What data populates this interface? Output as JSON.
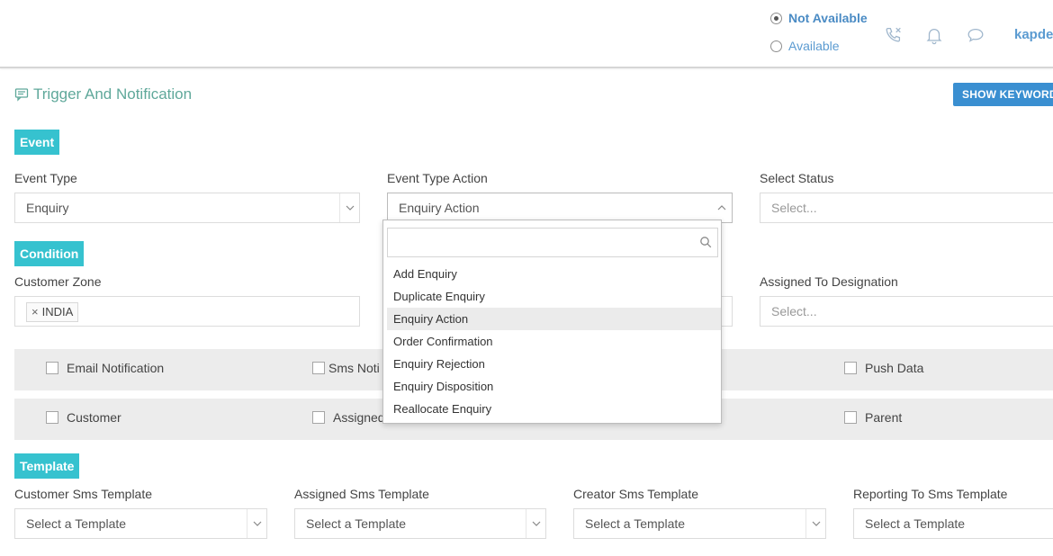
{
  "header": {
    "status_options": [
      {
        "label": "Not Available",
        "checked": true
      },
      {
        "label": "Available",
        "checked": false
      }
    ],
    "icons": [
      "phone-icon",
      "bell-icon",
      "chat-icon"
    ],
    "username": "kapde"
  },
  "page": {
    "title": "Trigger And Notification",
    "title_icon": "message-icon",
    "show_keyword_label": "SHOW KEYWORD"
  },
  "sections": {
    "event": "Event",
    "condition": "Condition",
    "template": "Template"
  },
  "event": {
    "event_type": {
      "label": "Event Type",
      "value": "Enquiry"
    },
    "event_type_action": {
      "label": "Event Type Action",
      "value": "Enquiry Action"
    },
    "select_status": {
      "label": "Select Status",
      "placeholder": "Select..."
    }
  },
  "condition": {
    "customer_zone": {
      "label": "Customer Zone",
      "tags": [
        "INDIA"
      ]
    },
    "assigned_designation": {
      "label": "Assigned To Designation",
      "placeholder": "Select..."
    }
  },
  "dropdown": {
    "search_value": "",
    "options": [
      "Add Enquiry",
      "Duplicate Enquiry",
      "Enquiry Action",
      "Order Confirmation",
      "Enquiry Rejection",
      "Enquiry Disposition",
      "Reallocate Enquiry"
    ],
    "selected": "Enquiry Action"
  },
  "checkbox_rows": [
    [
      "Email Notification",
      "Sms Noti",
      "Push Data"
    ],
    [
      "Customer",
      "Assigned",
      "Parent"
    ]
  ],
  "templates": [
    {
      "label": "Customer Sms Template",
      "placeholder": "Select a Template"
    },
    {
      "label": "Assigned Sms Template",
      "placeholder": "Select a Template"
    },
    {
      "label": "Creator Sms Template",
      "placeholder": "Select a Template"
    },
    {
      "label": "Reporting To Sms Template",
      "placeholder": "Select a Template"
    }
  ],
  "colors": {
    "accent_teal": "#36c2cf",
    "title_green": "#5fa89a",
    "link_blue": "#5b9bd1",
    "button_blue": "#3a8fd1"
  }
}
